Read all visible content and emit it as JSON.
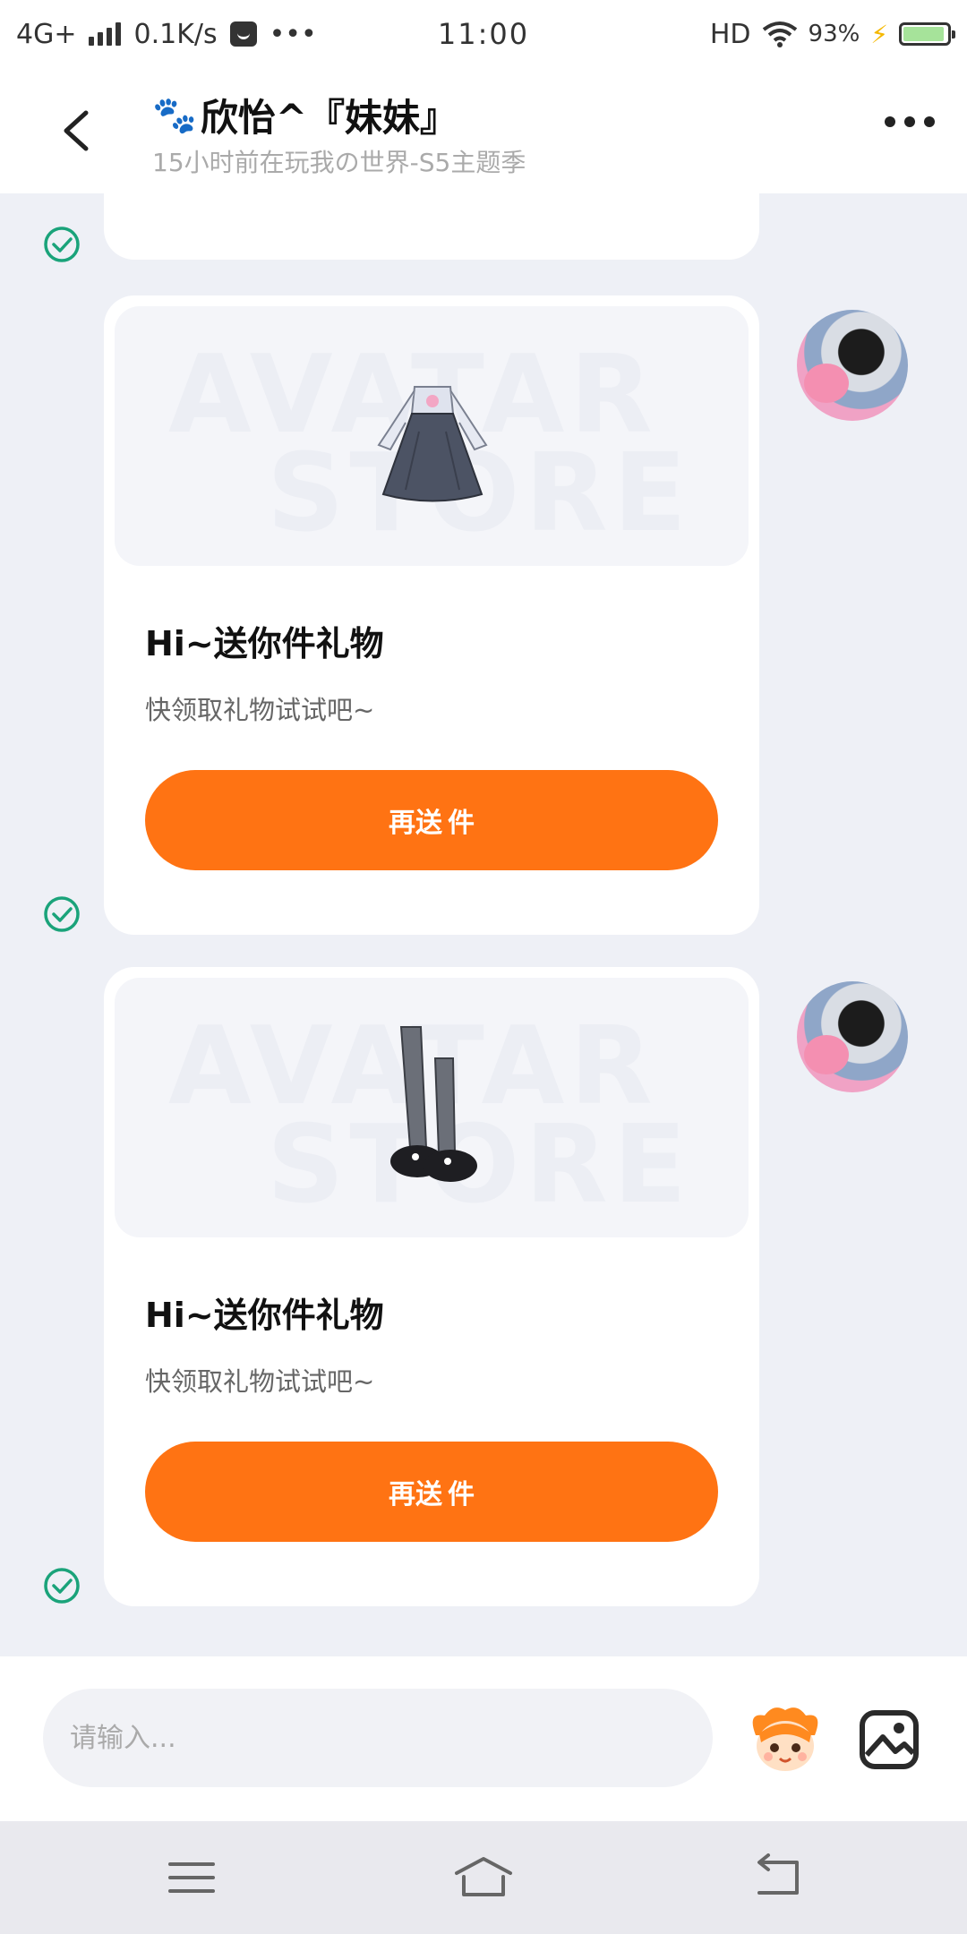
{
  "status_bar": {
    "network": "4G+",
    "speed": "0.1K/s",
    "dots": "•••",
    "time": "11:00",
    "hd": "HD",
    "battery": "93%",
    "battery_level": 0.93
  },
  "header": {
    "title": "欣怡^『妹妹』",
    "subtitle": "15小时前在玩我の世界-S5主题季"
  },
  "messages": [
    {
      "image_watermark_1": "AVATAR",
      "image_watermark_2": "STORE",
      "item_icon": "dress-icon",
      "title": "Hi~送你件礼物",
      "desc": "快领取礼物试试吧~",
      "button": "再送 件"
    },
    {
      "image_watermark_1": "AVATAR",
      "image_watermark_2": "STORE",
      "item_icon": "stockings-shoes-icon",
      "title": "Hi~送你件礼物",
      "desc": "快领取礼物试试吧~",
      "button": "再送 件"
    }
  ],
  "input": {
    "placeholder": "请输入..."
  },
  "colors": {
    "accent": "#ff7313",
    "check": "#1aa37a",
    "background": "#eef0f6"
  }
}
